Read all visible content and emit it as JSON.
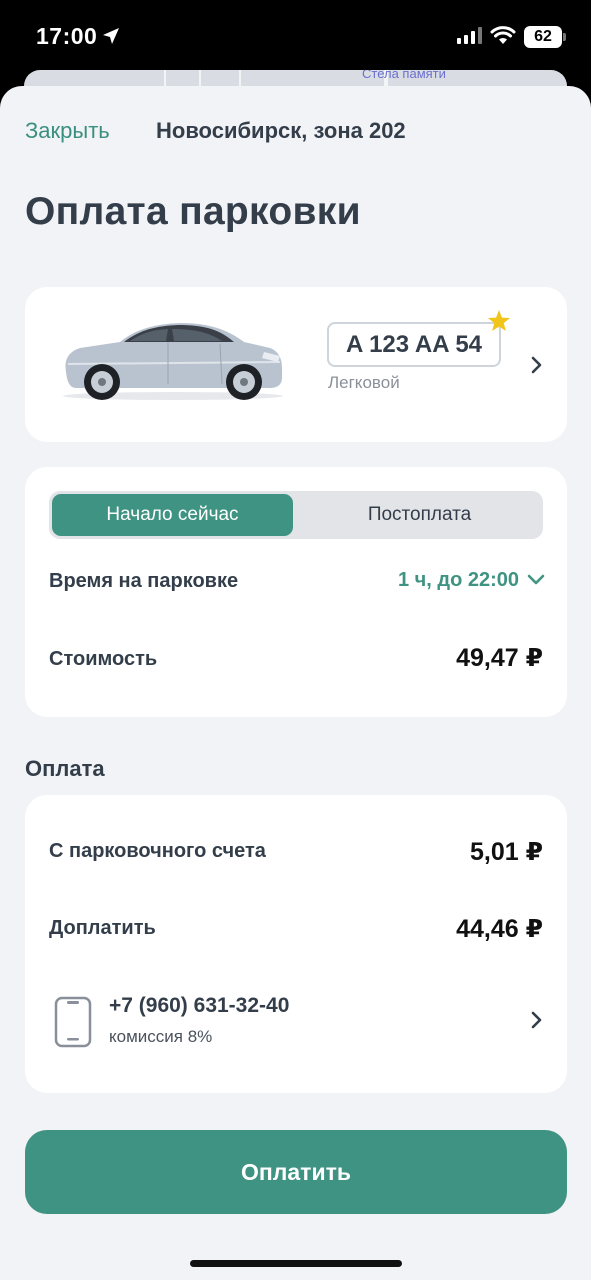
{
  "status_bar": {
    "time": "17:00",
    "battery": "62"
  },
  "map": {
    "label": "Стела памяти"
  },
  "header": {
    "close_label": "Закрыть",
    "zone_title": "Новосибирск, зона 202"
  },
  "page_title": "Оплата парковки",
  "vehicle": {
    "plate": "A 123 AA 54",
    "type": "Легковой",
    "favorite": true
  },
  "mode_tabs": [
    {
      "label": "Начало сейчас",
      "active": true
    },
    {
      "label": "Постоплата",
      "active": false
    }
  ],
  "parking": {
    "time_label": "Время на парковке",
    "time_value": "1 ч, до 22:00",
    "cost_label": "Стоимость",
    "cost_value": "49,47 ₽"
  },
  "payment": {
    "section_title": "Оплата",
    "account_label": "С парковочного счета",
    "account_value": "5,01 ₽",
    "topup_label": "Доплатить",
    "topup_value": "44,46 ₽",
    "phone": "+7 (960) 631-32-40",
    "commission": "комиссия 8%"
  },
  "pay_button_label": "Оплатить",
  "colors": {
    "accent": "#3f9382",
    "background": "#f2f3f6",
    "card": "#ffffff",
    "text": "#333e4a",
    "star": "#f0c419"
  }
}
